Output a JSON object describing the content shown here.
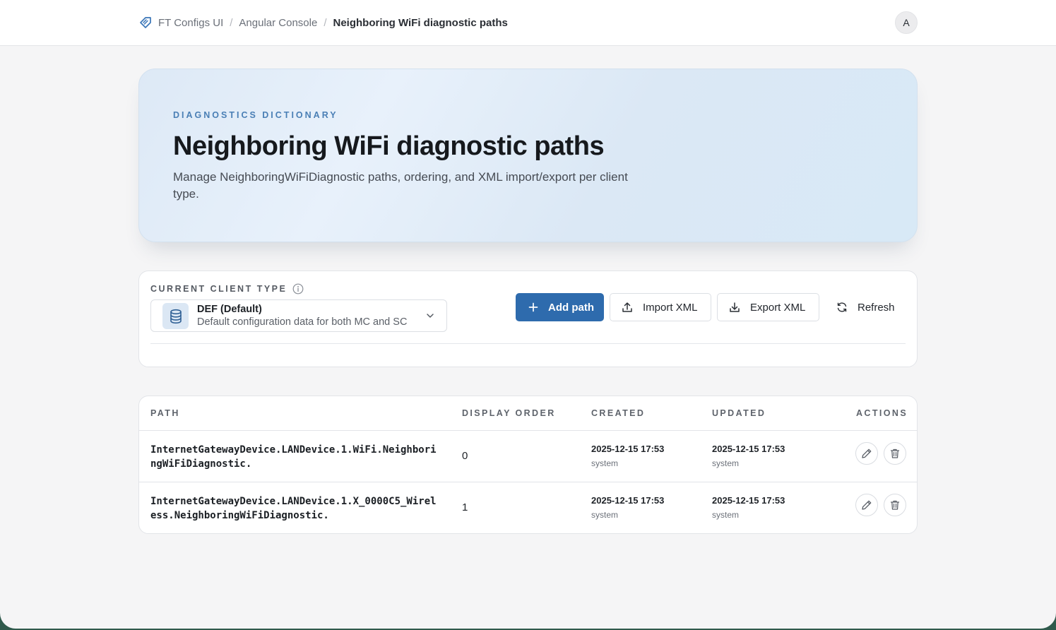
{
  "breadcrumb": {
    "items": [
      "FT Configs UI",
      "Angular Console"
    ],
    "current": "Neighboring WiFi diagnostic paths",
    "separator": "/"
  },
  "user": {
    "avatar_initial": "A"
  },
  "hero": {
    "eyebrow": "DIAGNOSTICS DICTIONARY",
    "title": "Neighboring WiFi diagnostic paths",
    "description": "Manage NeighboringWiFiDiagnostic paths, ordering, and XML import/export per client type."
  },
  "client_type": {
    "label": "CURRENT CLIENT TYPE",
    "selected_name": "DEF (Default)",
    "selected_description": "Default configuration data for both MC and SC"
  },
  "toolbar": {
    "add_label": "Add path",
    "import_label": "Import XML",
    "export_label": "Export XML",
    "refresh_label": "Refresh"
  },
  "table": {
    "headers": {
      "path": "PATH",
      "display_order": "DISPLAY ORDER",
      "created": "CREATED",
      "updated": "UPDATED",
      "actions": "ACTIONS"
    },
    "rows": [
      {
        "path": "InternetGatewayDevice.LANDevice.1.WiFi.NeighboringWiFiDiagnostic.",
        "display_order": "0",
        "created": "2025-12-15 17:53",
        "created_by": "system",
        "updated": "2025-12-15 17:53",
        "updated_by": "system"
      },
      {
        "path": "InternetGatewayDevice.LANDevice.1.X_0000C5_Wireless.NeighboringWiFiDiagnostic.",
        "display_order": "1",
        "created": "2025-12-15 17:53",
        "created_by": "system",
        "updated": "2025-12-15 17:53",
        "updated_by": "system"
      }
    ]
  },
  "colors": {
    "accent": "#2e6bad",
    "eyebrow": "#4a7fb5",
    "page_bg": "#f5f5f6"
  }
}
